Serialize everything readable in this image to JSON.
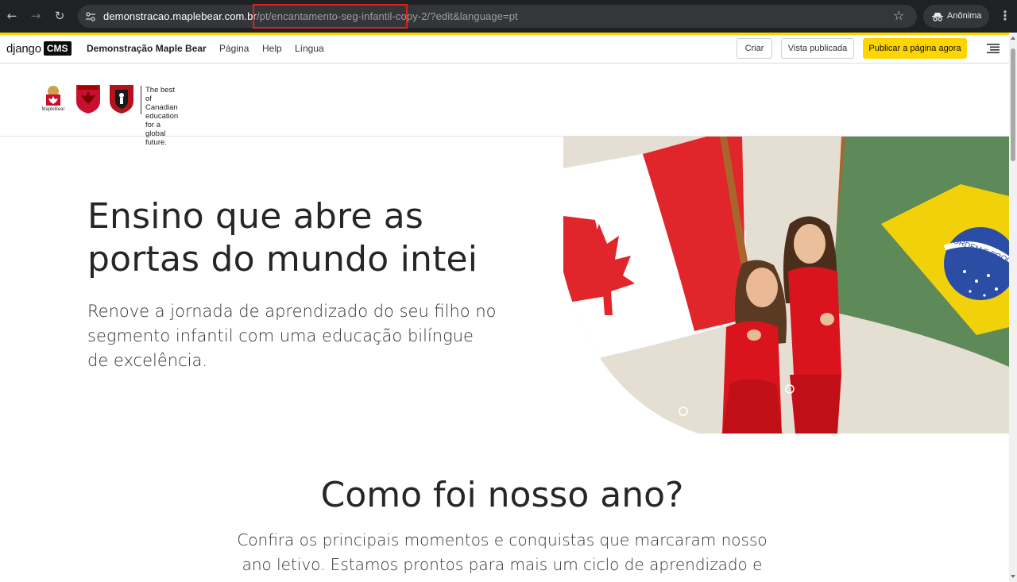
{
  "browser": {
    "url_host": "demonstracao.maplebear.com.br",
    "url_path": "/pt/encantamento-seg-infantil-copy-2/?edit&language=pt",
    "profile_label": "Anônima"
  },
  "cms_toolbar": {
    "logo_text": "django",
    "logo_badge": "CMS",
    "site_name": "Demonstração Maple Bear",
    "menu": [
      "Página",
      "Help",
      "Língua"
    ],
    "btn_create": "Criar",
    "btn_published": "Vista publicada",
    "btn_publish": "Publicar a página agora",
    "accent_color": "#ffd500"
  },
  "header": {
    "logo_small_text": "MapleBear",
    "tagline_lines": [
      "The best of",
      "Canadian education",
      "for a global future."
    ]
  },
  "hero": {
    "title_line1": "Ensino que abre as",
    "title_line2": "portas do mundo intei",
    "subtitle_line1": "Renove a jornada de aprendizado do seu filho no",
    "subtitle_line2": "segmento infantil com uma educação bilíngue",
    "subtitle_line3": "de excelência.",
    "flag_text": "ORDEM E PROG"
  },
  "section": {
    "title": "Como foi nosso ano?",
    "text_line1": "Confira os principais momentos e conquistas que marcaram nosso",
    "text_line2": "ano letivo. Estamos prontos para mais um ciclo de aprendizado e"
  },
  "icons": {
    "back": "arrow-left-icon",
    "forward": "arrow-right-icon",
    "reload": "reload-icon",
    "site_info": "tune-icon",
    "bookmark": "star-icon",
    "incognito": "incognito-icon",
    "menu": "kebab-menu-icon",
    "structure": "structure-toggle-icon"
  }
}
